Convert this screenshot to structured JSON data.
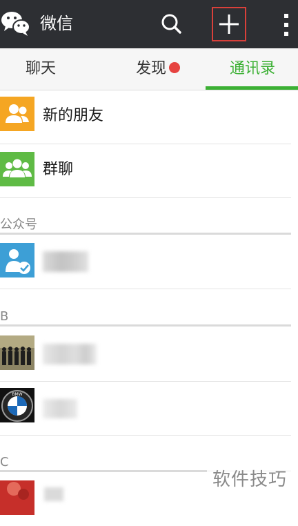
{
  "header": {
    "title": "微信",
    "icons": {
      "logo": "wechat-logo-icon",
      "search": "search-icon",
      "add": "plus-icon",
      "more": "more-vertical-icon"
    },
    "background_color": "#2d2f33",
    "highlight_border_color": "#d9403a"
  },
  "tabs": [
    {
      "label": "聊天",
      "selected": false
    },
    {
      "label": "发现",
      "selected": false,
      "badge": "red-dot"
    },
    {
      "label": "通讯录",
      "selected": true
    }
  ],
  "accent_color": "#3cb034",
  "contacts": {
    "top_items": [
      {
        "label": "新的朋友",
        "icon": "add-friend-icon",
        "icon_color": "#f5a623"
      },
      {
        "label": "群聊",
        "icon": "group-chat-icon",
        "icon_color": "#5fbb45"
      }
    ],
    "sections": [
      {
        "header": "公众号",
        "items": [
          {
            "name_hidden": true,
            "avatar": "official-account-icon",
            "avatar_color": "#3d9fd6"
          }
        ]
      },
      {
        "header": "B",
        "items": [
          {
            "name_hidden": true,
            "avatar": "group-photo-avatar"
          },
          {
            "name_hidden": true,
            "avatar": "bmw-logo-avatar"
          }
        ]
      },
      {
        "header": "C",
        "items": [
          {
            "name_hidden": true,
            "avatar": "red-avatar"
          }
        ]
      }
    ]
  },
  "watermark": "软件技巧"
}
